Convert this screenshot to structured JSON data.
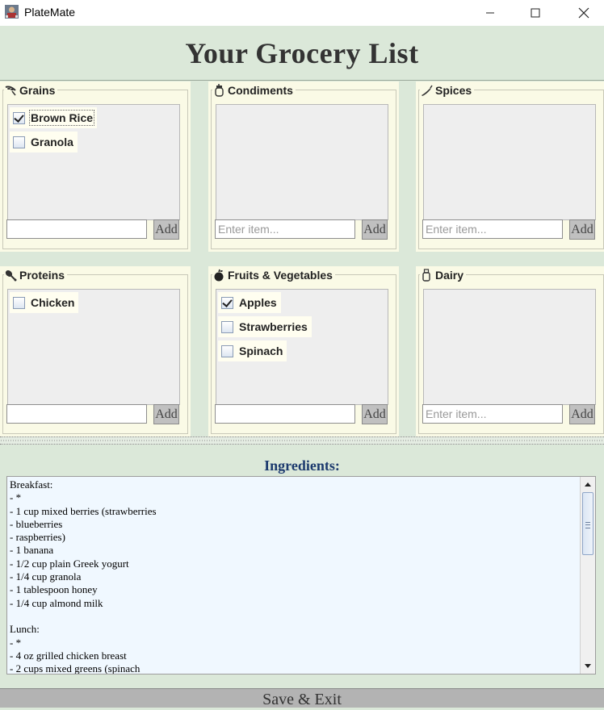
{
  "window": {
    "title": "PlateMate"
  },
  "header": {
    "title": "Your Grocery List"
  },
  "categories": [
    {
      "label": "Grains",
      "icon": "grain-icon",
      "items": [
        {
          "label": "Brown Rice",
          "checked": true
        },
        {
          "label": "Granola",
          "checked": false
        }
      ],
      "input_value": "",
      "input_placeholder": "",
      "add_label": "Add"
    },
    {
      "label": "Condiments",
      "icon": "condiment-jar-icon",
      "items": [],
      "input_value": "",
      "input_placeholder": "Enter item...",
      "add_label": "Add"
    },
    {
      "label": "Spices",
      "icon": "pepper-icon",
      "items": [],
      "input_value": "",
      "input_placeholder": "Enter item...",
      "add_label": "Add"
    },
    {
      "label": "Proteins",
      "icon": "drumstick-icon",
      "items": [
        {
          "label": "Chicken",
          "checked": false
        }
      ],
      "input_value": "",
      "input_placeholder": "",
      "add_label": "Add"
    },
    {
      "label": "Fruits & Vegetables",
      "icon": "apple-icon",
      "items": [
        {
          "label": "Apples",
          "checked": true
        },
        {
          "label": "Strawberries",
          "checked": false
        },
        {
          "label": "Spinach",
          "checked": false
        }
      ],
      "input_value": "",
      "input_placeholder": "",
      "add_label": "Add"
    },
    {
      "label": "Dairy",
      "icon": "milk-bottle-icon",
      "items": [],
      "input_value": "",
      "input_placeholder": "Enter item...",
      "add_label": "Add"
    }
  ],
  "ingredients": {
    "heading": "Ingredients:",
    "lines": [
      "Breakfast:",
      "- *",
      "- 1 cup mixed berries (strawberries",
      "- blueberries",
      "- raspberries)",
      "- 1 banana",
      "- 1/2 cup plain Greek yogurt",
      "- 1/4 cup granola",
      "- 1 tablespoon honey",
      "- 1/4 cup almond milk",
      "",
      "Lunch:",
      "- *",
      "- 4 oz grilled chicken breast",
      "- 2 cups mixed greens (spinach"
    ]
  },
  "footer": {
    "save_label": "Save & Exit"
  },
  "colors": {
    "background": "#dbe8d9",
    "panel": "#fafae6",
    "list_box": "#eeeeee",
    "ingredients_bg": "#f0f8ff",
    "ingredients_heading": "#1c3a6e",
    "save_bar": "#b3b3b3"
  }
}
